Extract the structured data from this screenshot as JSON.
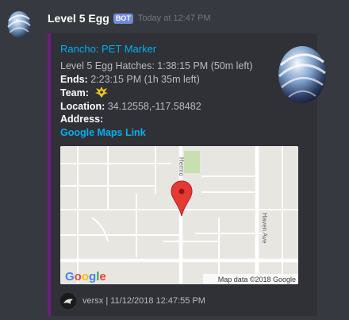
{
  "message": {
    "author": "Level 5 Egg",
    "bot_tag": "BOT",
    "timestamp": "Today at 12:47 PM",
    "avatar_icon": "egg-icon"
  },
  "embed": {
    "accent_color": "#6b1f80",
    "title": "Rancho: PET Marker",
    "hatch_line": "Level 5 Egg Hatches: 1:38:15 PM (50m left)",
    "ends_label": "Ends:",
    "ends_value": "2:23:15 PM (1h 35m left)",
    "team_label": "Team:",
    "team_icon": "instinct-team-icon",
    "location_label": "Location:",
    "location_value": "34.12558,-117.58482",
    "address_label": "Address:",
    "maps_link": "Google Maps Link",
    "thumbnail_icon": "egg-icon",
    "map": {
      "street_hermosa": "Hermo",
      "street_haven": "Haven Ave",
      "logo": "Google",
      "attribution": "Map data ©2018 Google"
    },
    "footer": {
      "icon": "user-avatar-icon",
      "text": "versx | 11/12/2018 12:47:55 PM"
    }
  }
}
